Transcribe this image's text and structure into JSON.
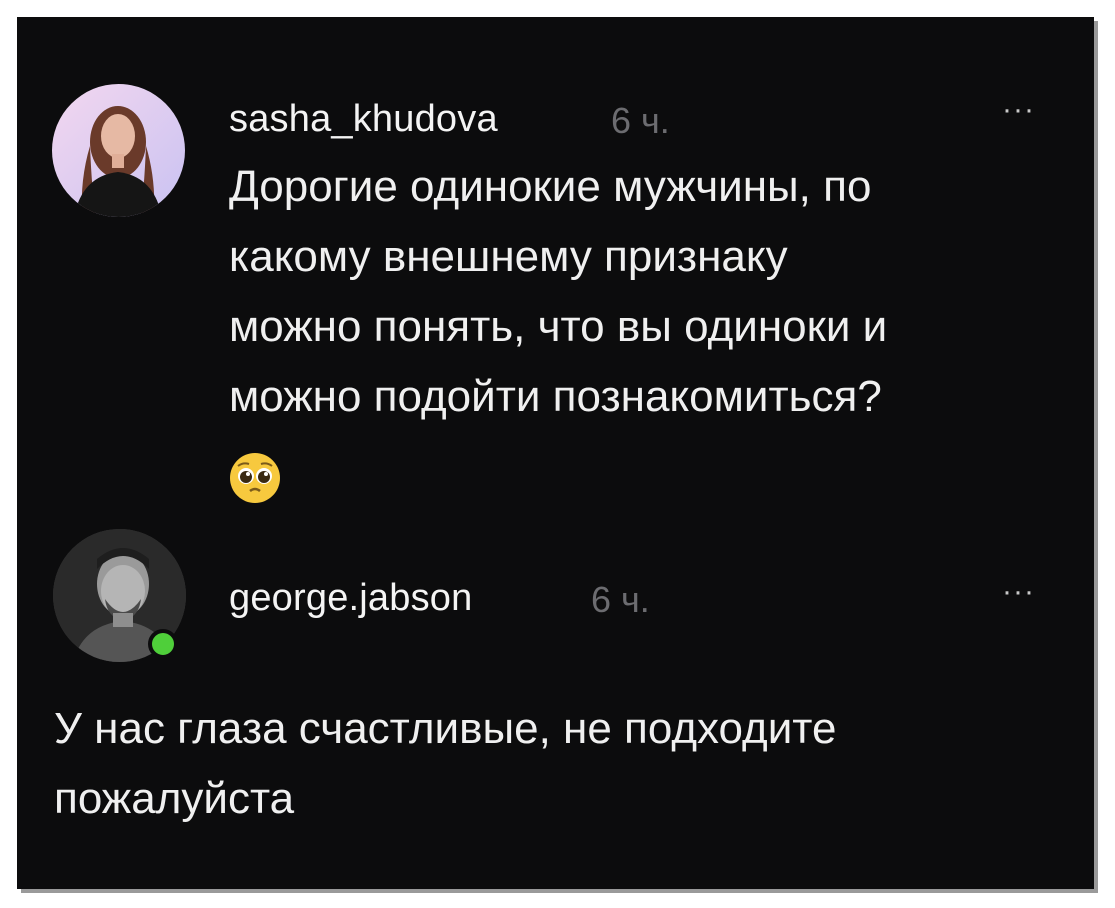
{
  "comments": [
    {
      "username": "sasha_khudova",
      "time": "6 ч.",
      "more": "···",
      "text": "Дорогие одинокие мужчины, по\nкакому внешнему признаку\nможно понять, что вы одиноки и\nможно подойти познакомиться?",
      "emoji": "pleading-face-icon"
    },
    {
      "username": "george.jabson",
      "time": "6 ч.",
      "more": "···",
      "online": true,
      "text": "У нас глаза счастливые, не подходите\nпожалуйста"
    }
  ],
  "colors": {
    "background": "#0c0c0d",
    "text": "#f0f0f0",
    "timestamp": "#6c6c70",
    "online": "#4fcf3a"
  }
}
